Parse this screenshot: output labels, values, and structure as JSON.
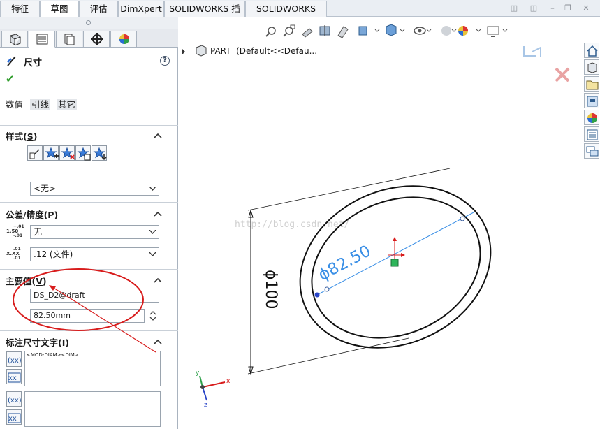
{
  "tabs": [
    {
      "label": "特征",
      "active": false
    },
    {
      "label": "草图",
      "active": true
    },
    {
      "label": "评估",
      "active": false
    },
    {
      "label": "DimXpert",
      "active": false
    },
    {
      "label": "SOLIDWORKS 插件",
      "active": false
    },
    {
      "label": "SOLIDWORKS MBD",
      "active": false
    }
  ],
  "property_manager": {
    "title": "尺寸",
    "help_label": "?",
    "subtabs": [
      "数值",
      "引线",
      "其它"
    ],
    "style_section": {
      "title": "样式",
      "accel": "S",
      "select_value": "<无>"
    },
    "tolerance_section": {
      "title": "公差/精度",
      "accel": "P",
      "tolerance_value": "无",
      "precision_value": ".12 (文件)",
      "tol_icon_text": {
        "top": "+.01",
        "mid": "1.50",
        "bot": "-.01"
      },
      "prec_icon_text": {
        "top": ".01",
        "mid": "X.XX",
        "bot": ".01"
      }
    },
    "primary_value_section": {
      "title": "主要值",
      "accel": "V",
      "name_field": "DS_D2@draft",
      "value_field": "82.50mm"
    },
    "dim_text_section": {
      "title": "标注尺寸文字",
      "accel": "I",
      "text_value": "<MOD-DIAM><DIM>"
    }
  },
  "graphics": {
    "tree_root": "PART",
    "tree_config": "(Default<<Defau...",
    "dim_inner": "ϕ82.50",
    "dim_outer": "ϕ100",
    "watermark": "http://blog.csdn.net/",
    "triad": {
      "x": "x",
      "y": "y",
      "z": "z"
    }
  },
  "colors": {
    "accent_blue": "#3a8fe6",
    "annotation_red": "#d81c1c",
    "tab_border": "#b9c2cd"
  }
}
